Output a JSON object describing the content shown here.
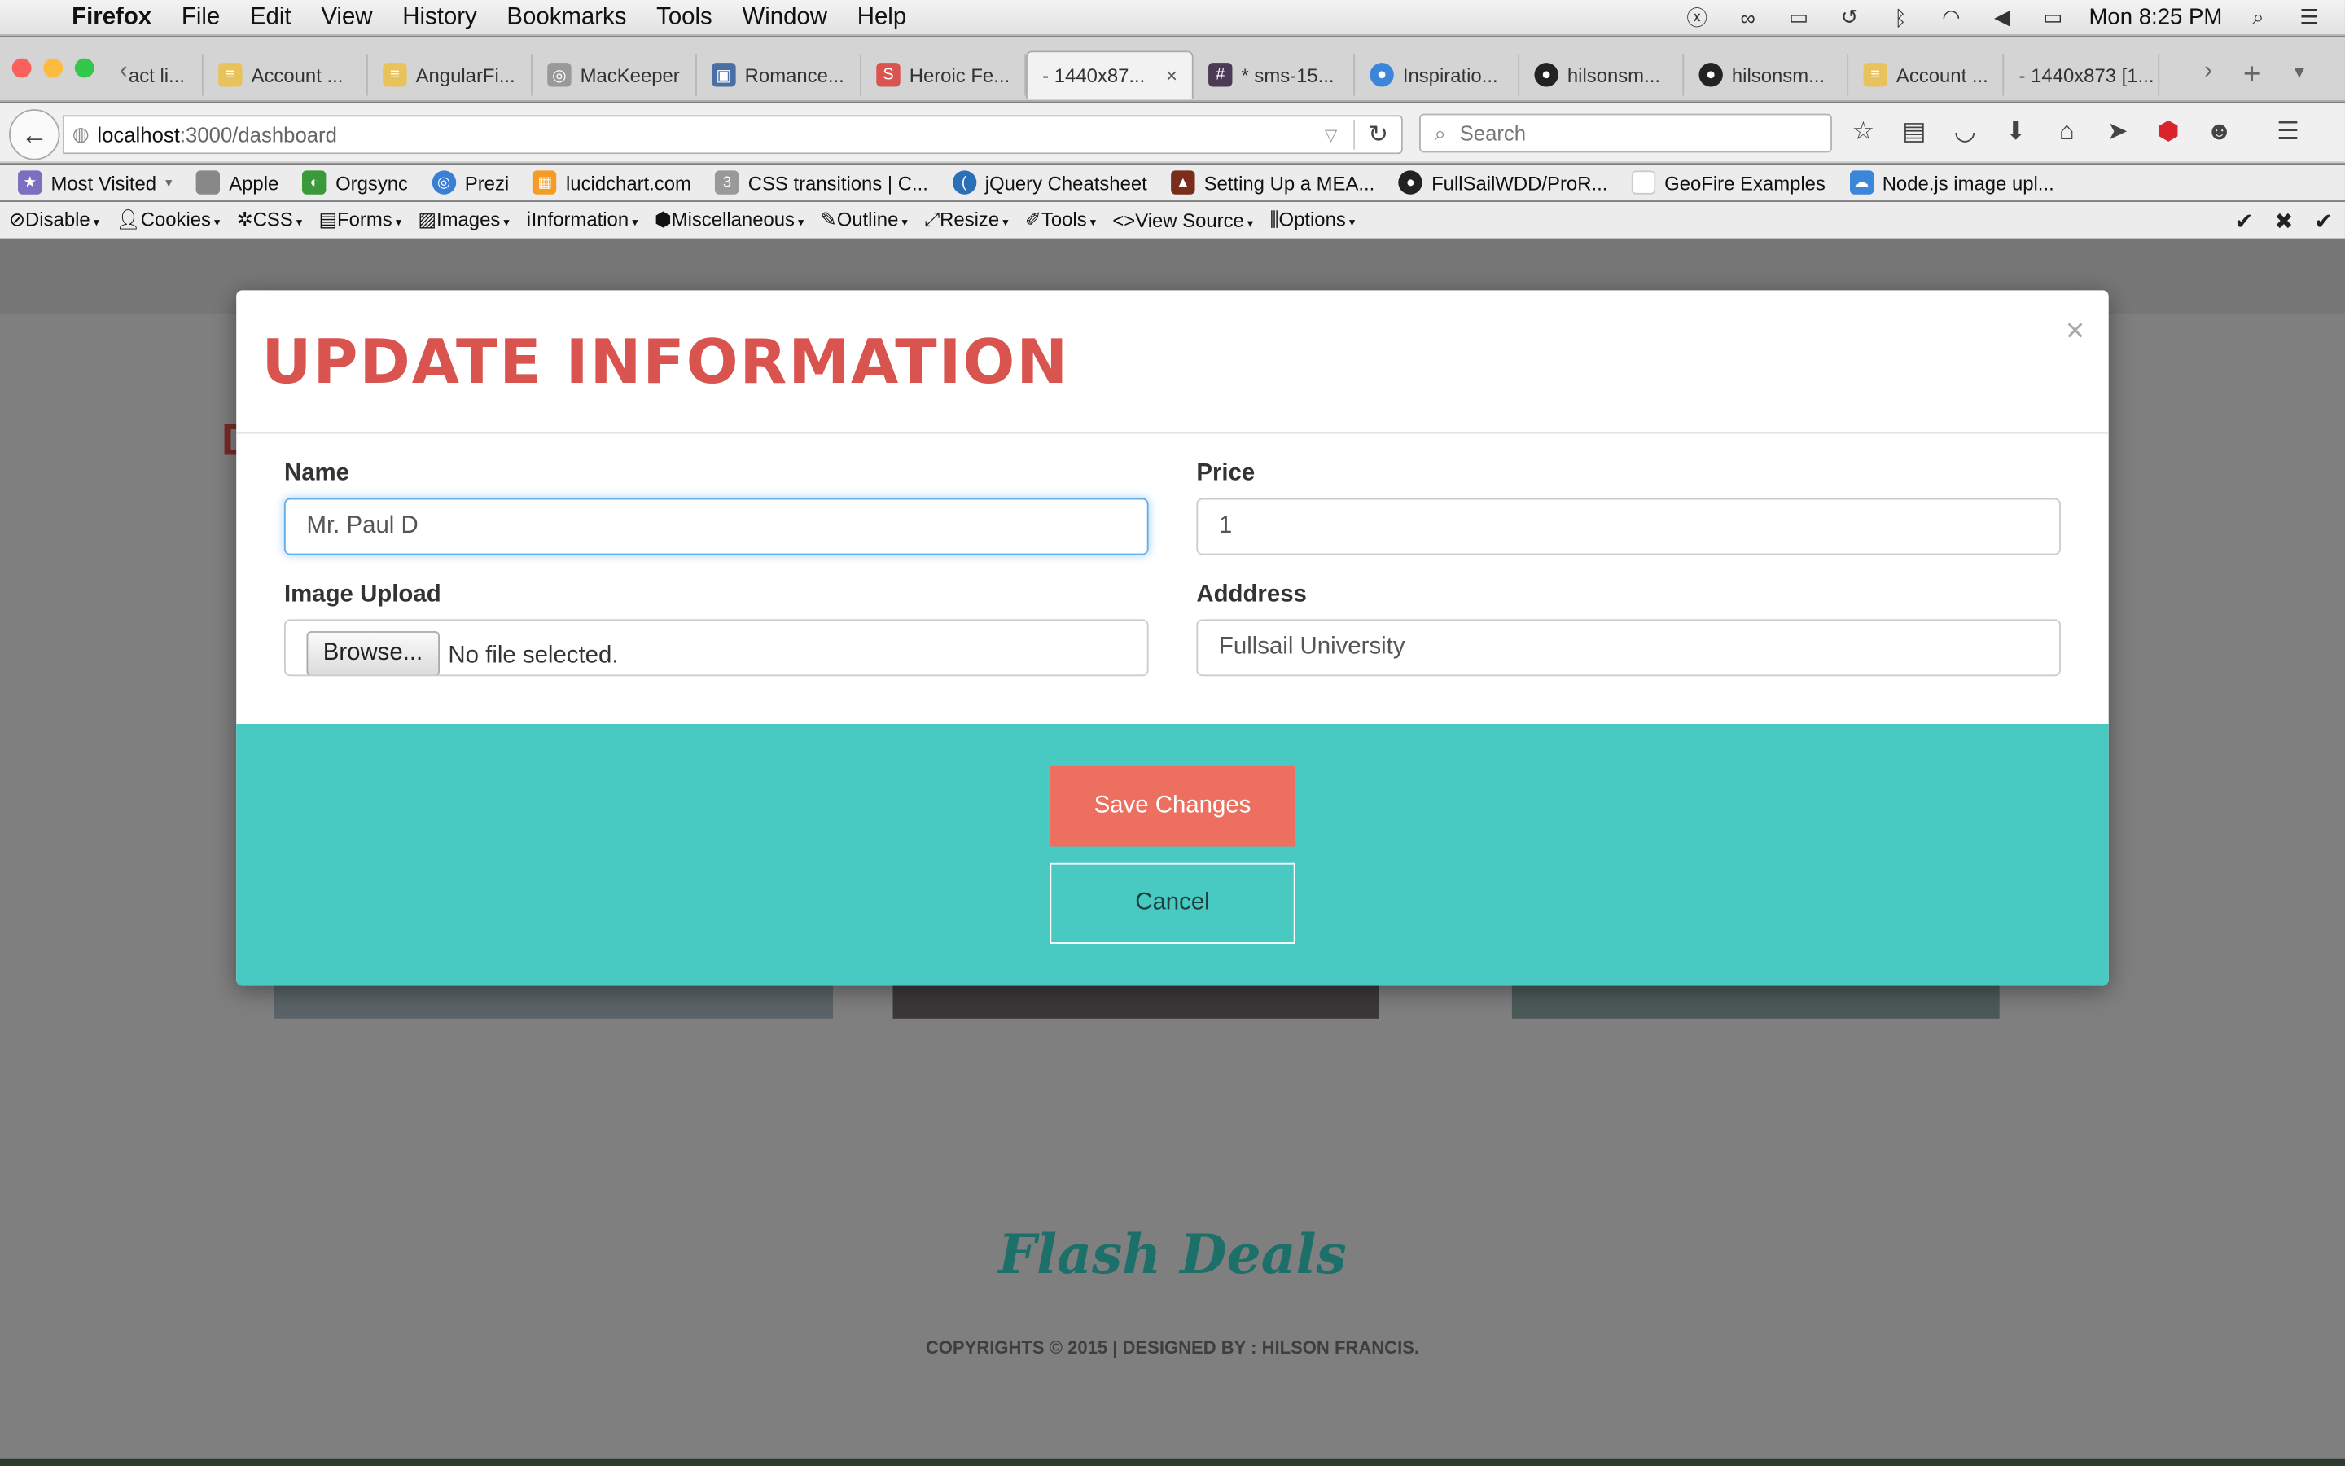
{
  "os_menu": {
    "app": "Firefox",
    "items": [
      "File",
      "Edit",
      "View",
      "History",
      "Bookmarks",
      "Tools",
      "Window",
      "Help"
    ],
    "clock": "Mon 8:25 PM"
  },
  "tabs": [
    {
      "label": "act li...",
      "icon": "page-icon"
    },
    {
      "label": "Account ...",
      "icon": "database-icon"
    },
    {
      "label": "AngularFi...",
      "icon": "database-icon"
    },
    {
      "label": "MacKeeper",
      "icon": "mackeeper-icon"
    },
    {
      "label": "Romance...",
      "icon": "film-icon"
    },
    {
      "label": "Heroic Fe...",
      "icon": "s-icon"
    },
    {
      "label": "- 1440x87...",
      "icon": "none",
      "active": true
    },
    {
      "label": "* sms-15...",
      "icon": "hash-icon"
    },
    {
      "label": "Inspiratio...",
      "icon": "drop-icon"
    },
    {
      "label": "hilsonsm...",
      "icon": "github-icon"
    },
    {
      "label": "hilsonsm...",
      "icon": "github-icon"
    },
    {
      "label": "Account ...",
      "icon": "database-icon"
    },
    {
      "label": "- 1440x873 [1...",
      "icon": "none"
    }
  ],
  "urlbar": {
    "host": "localhost",
    "path": ":3000/dashboard"
  },
  "search": {
    "placeholder": "Search"
  },
  "bookmarks": [
    {
      "label": "Most Visited",
      "icon": "folder-icon",
      "color": "#7d6fc0"
    },
    {
      "label": "Apple",
      "icon": "apple-icon",
      "color": "#888888"
    },
    {
      "label": "Orgsync",
      "icon": "orgsync-icon",
      "color": "#3a9a3a"
    },
    {
      "label": "Prezi",
      "icon": "prezi-icon",
      "color": "#3a7fd6"
    },
    {
      "label": "lucidchart.com",
      "icon": "lucid-icon",
      "color": "#f59b28"
    },
    {
      "label": "CSS transitions | C...",
      "icon": "css3-icon",
      "color": "#999999"
    },
    {
      "label": "jQuery Cheatsheet",
      "icon": "jquery-icon",
      "color": "#2b6fb6"
    },
    {
      "label": "Setting Up a MEA...",
      "icon": "mean-icon",
      "color": "#7a2d1a"
    },
    {
      "label": "FullSailWDD/ProR...",
      "icon": "github-icon",
      "color": "#222222"
    },
    {
      "label": "GeoFire Examples",
      "icon": "page-icon",
      "color": "#dddddd"
    },
    {
      "label": "Node.js image upl...",
      "icon": "cloud-icon",
      "color": "#3b86d8"
    }
  ],
  "devtoolbar": [
    "Disable",
    "Cookies",
    "CSS",
    "Forms",
    "Images",
    "Information",
    "Miscellaneous",
    "Outline",
    "Resize",
    "Tools",
    "View Source",
    "Options"
  ],
  "modal": {
    "title": "UPDATE INFORMATION",
    "close": "×",
    "name_label": "Name",
    "name_value": "Mr. Paul D",
    "price_label": "Price",
    "price_value": "1",
    "image_label": "Image Upload",
    "browse_label": "Browse...",
    "no_file": "No file selected.",
    "address_label": "Adddress",
    "address_value": "Fullsail University",
    "save_label": "Save Changes",
    "cancel_label": "Cancel"
  },
  "page": {
    "heading_letter": "D",
    "logo": "Flash Deals",
    "copyright": "COPYRIGHTS © 2015 | DESIGNED BY : HILSON FRANCIS."
  },
  "colors": {
    "accent_red": "#d9534f",
    "save_button": "#ec6f60",
    "footer_teal": "#48c9c2",
    "logo_teal": "#1d6f6a"
  }
}
